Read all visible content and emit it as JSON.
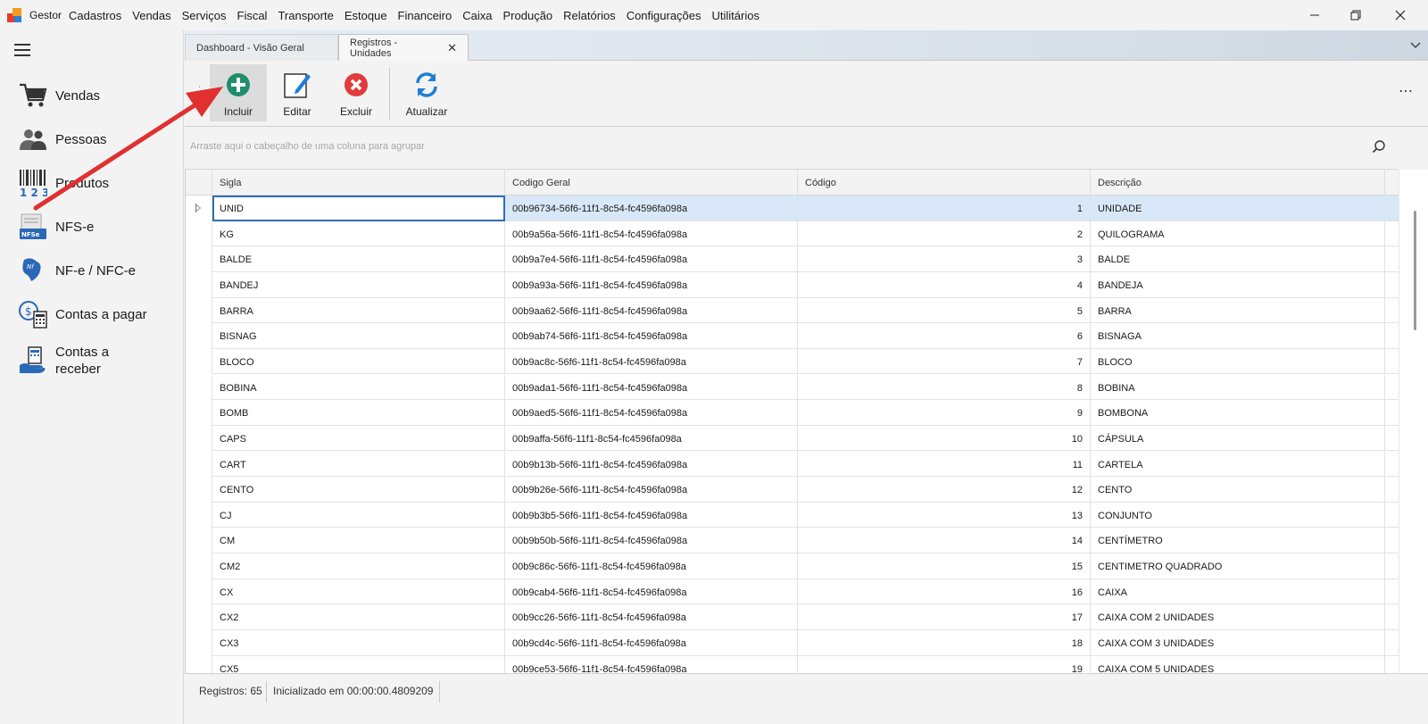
{
  "app": {
    "name": "Gestor",
    "menu": [
      "Cadastros",
      "Vendas",
      "Serviços",
      "Fiscal",
      "Transporte",
      "Estoque",
      "Financeiro",
      "Caixa",
      "Produção",
      "Relatórios",
      "Configurações",
      "Utilitários"
    ]
  },
  "window_controls": {
    "minimize": "—",
    "restore": "❐",
    "close": "✕"
  },
  "sidebar": {
    "items": [
      {
        "label": "Vendas",
        "icon": "cart-icon"
      },
      {
        "label": "Pessoas",
        "icon": "people-icon"
      },
      {
        "label": "Produtos",
        "icon": "barcode-icon"
      },
      {
        "label": "NFS-e",
        "icon": "nfse-icon"
      },
      {
        "label": "NF-e / NFC-e",
        "icon": "nfe-icon"
      },
      {
        "label": "Contas a pagar",
        "icon": "bills-icon"
      },
      {
        "label": "Contas a receber",
        "label_line1": "Contas a",
        "label_line2": "receber",
        "icon": "receivable-icon"
      }
    ]
  },
  "tabs": [
    {
      "label": "Dashboard - Visão Geral",
      "active": false
    },
    {
      "label": "Registros - Unidades",
      "active": true,
      "close": "✕"
    }
  ],
  "toolbar": {
    "add_label": "Incluir",
    "edit_label": "Editar",
    "delete_label": "Excluir",
    "refresh_label": "Atualizar",
    "more": "⋯",
    "grip": "⁚"
  },
  "grouppanel": {
    "hint": "Arraste aqui o cabeçalho de uma coluna para agrupar"
  },
  "grid": {
    "columns": [
      "Sigla",
      "Codigo Geral",
      "Código",
      "Descrição"
    ],
    "rows": [
      [
        "UNID",
        "00b96734-56f6-11f1-8c54-fc4596fa098a",
        "1",
        "UNIDADE"
      ],
      [
        "KG",
        "00b9a56a-56f6-11f1-8c54-fc4596fa098a",
        "2",
        "QUILOGRAMA"
      ],
      [
        "BALDE",
        "00b9a7e4-56f6-11f1-8c54-fc4596fa098a",
        "3",
        "BALDE"
      ],
      [
        "BANDEJ",
        "00b9a93a-56f6-11f1-8c54-fc4596fa098a",
        "4",
        "BANDEJA"
      ],
      [
        "BARRA",
        "00b9aa62-56f6-11f1-8c54-fc4596fa098a",
        "5",
        "BARRA"
      ],
      [
        "BISNAG",
        "00b9ab74-56f6-11f1-8c54-fc4596fa098a",
        "6",
        "BISNAGA"
      ],
      [
        "BLOCO",
        "00b9ac8c-56f6-11f1-8c54-fc4596fa098a",
        "7",
        "BLOCO"
      ],
      [
        "BOBINA",
        "00b9ada1-56f6-11f1-8c54-fc4596fa098a",
        "8",
        "BOBINA"
      ],
      [
        "BOMB",
        "00b9aed5-56f6-11f1-8c54-fc4596fa098a",
        "9",
        "BOMBONA"
      ],
      [
        "CAPS",
        "00b9affa-56f6-11f1-8c54-fc4596fa098a",
        "10",
        "CÁPSULA"
      ],
      [
        "CART",
        "00b9b13b-56f6-11f1-8c54-fc4596fa098a",
        "11",
        "CARTELA"
      ],
      [
        "CENTO",
        "00b9b26e-56f6-11f1-8c54-fc4596fa098a",
        "12",
        "CENTO"
      ],
      [
        "CJ",
        "00b9b3b5-56f6-11f1-8c54-fc4596fa098a",
        "13",
        "CONJUNTO"
      ],
      [
        "CM",
        "00b9b50b-56f6-11f1-8c54-fc4596fa098a",
        "14",
        "CENTÍMETRO"
      ],
      [
        "CM2",
        "00b9c86c-56f6-11f1-8c54-fc4596fa098a",
        "15",
        "CENTIMETRO QUADRADO"
      ],
      [
        "CX",
        "00b9cab4-56f6-11f1-8c54-fc4596fa098a",
        "16",
        "CAIXA"
      ],
      [
        "CX2",
        "00b9cc26-56f6-11f1-8c54-fc4596fa098a",
        "17",
        "CAIXA COM 2 UNIDADES"
      ],
      [
        "CX3",
        "00b9cd4c-56f6-11f1-8c54-fc4596fa098a",
        "18",
        "CAIXA COM 3 UNIDADES"
      ],
      [
        "CX5",
        "00b9ce53-56f6-11f1-8c54-fc4596fa098a",
        "19",
        "CAIXA COM 5 UNIDADES"
      ]
    ]
  },
  "status": {
    "records": "Registros: 65",
    "init_time": "Inicializado em 00:00:00.4809209"
  },
  "colors": {
    "accent_add": "#1e8f6a",
    "accent_delete": "#e23b3b",
    "accent_refresh": "#1e7fd6",
    "selection": "#d8e8f8",
    "annotation_arrow": "#e03030"
  }
}
